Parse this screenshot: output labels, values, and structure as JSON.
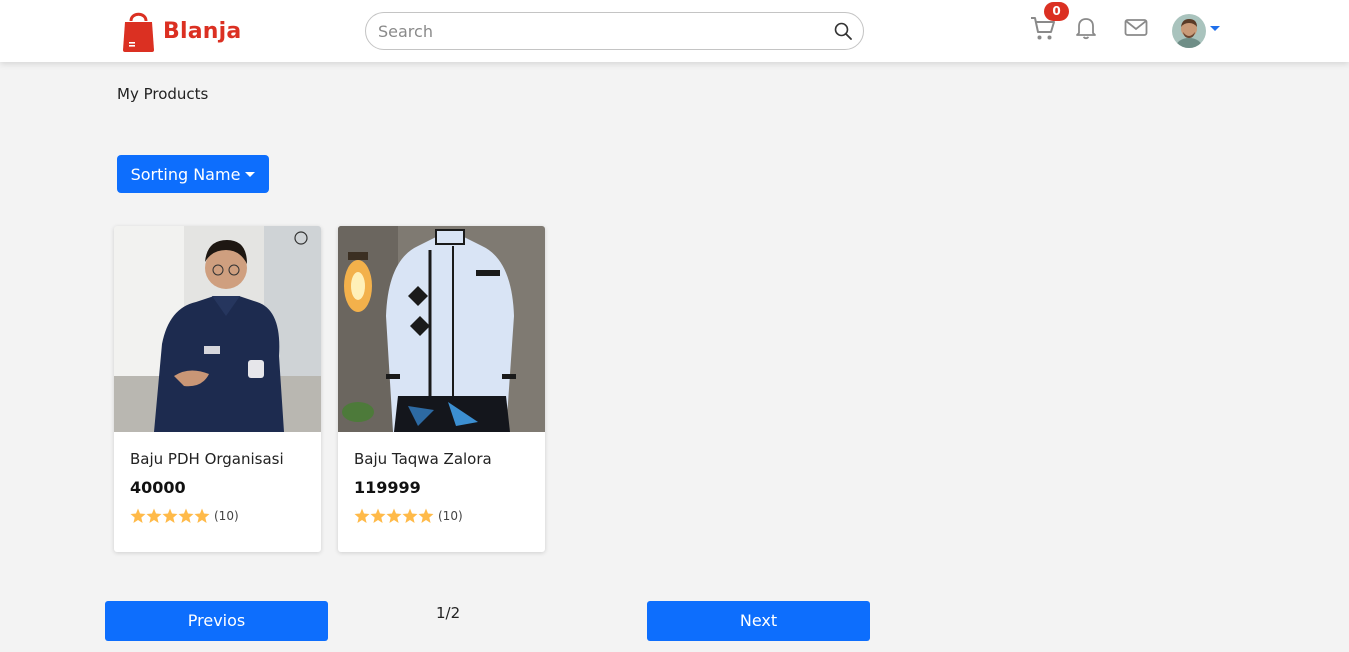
{
  "header": {
    "brand": "Blanja",
    "search_placeholder": "Search",
    "cart_count": "0"
  },
  "page": {
    "title": "My Products",
    "sort_label": "Sorting Name"
  },
  "products": [
    {
      "name": "Baju PDH Organisasi",
      "price": "40000",
      "rating": 5,
      "reviews": "(10)"
    },
    {
      "name": "Baju Taqwa Zalora",
      "price": "119999",
      "rating": 5,
      "reviews": "(10)"
    }
  ],
  "pagination": {
    "prev_label": "Previos",
    "page_indicator": "1/2",
    "next_label": "Next"
  },
  "colors": {
    "brand_red": "#db3022",
    "primary_blue": "#0d6efd",
    "star": "#ffba49"
  },
  "icons": [
    "shopping-bag-icon",
    "search-icon",
    "cart-icon",
    "bell-icon",
    "mail-icon",
    "star-icon",
    "caret-down-icon"
  ]
}
